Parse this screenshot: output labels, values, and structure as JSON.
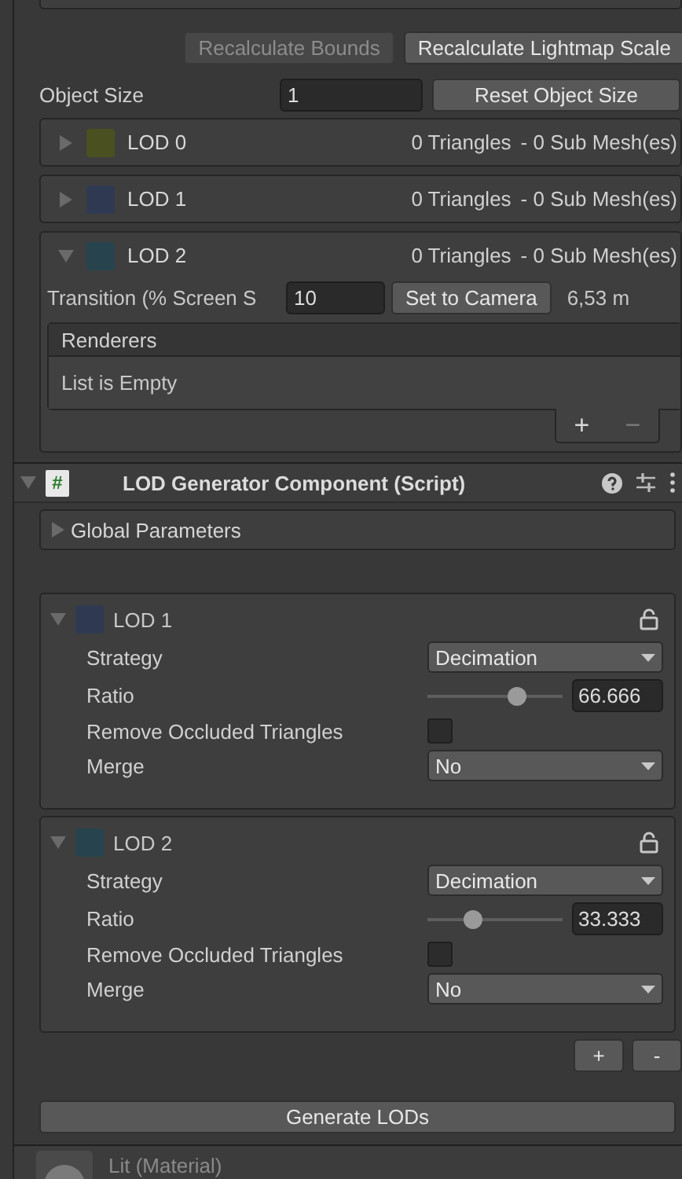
{
  "toolbar": {
    "buttons": [
      {
        "label": "Recalculate Bounds",
        "disabled": true
      },
      {
        "label": "Recalculate Lightmap Scale",
        "disabled": false
      }
    ]
  },
  "object_size": {
    "label": "Object Size",
    "value": "1",
    "button": "Reset Object Size"
  },
  "lod_group": [
    {
      "name": "LOD 0",
      "color": "#4a5020",
      "expanded": false,
      "triangles": "0 Triangles",
      "submeshes": "- 0 Sub Mesh(es)"
    },
    {
      "name": "LOD 1",
      "color": "#2f3a52",
      "expanded": false,
      "triangles": "0 Triangles",
      "submeshes": "- 0 Sub Mesh(es)"
    },
    {
      "name": "LOD 2",
      "color": "#27444e",
      "expanded": true,
      "triangles": "0 Triangles",
      "submeshes": "- 0 Sub Mesh(es)"
    }
  ],
  "transition": {
    "label": "Transition (% Screen S",
    "value": "10",
    "button": "Set to Camera",
    "reading": "6,53 m"
  },
  "renderers": {
    "header": "Renderers",
    "empty_text": "List is Empty",
    "add": "+",
    "remove": "−"
  },
  "component": {
    "title": "LOD Generator Component (Script)",
    "expanded": true,
    "icon_glyph": "#",
    "global_parameters": {
      "label": "Global Parameters",
      "expanded": false
    },
    "lods": [
      {
        "name": "LOD 1",
        "color": "#2f3a52",
        "expanded": true,
        "strategy_label": "Strategy",
        "strategy": "Decimation",
        "ratio_label": "Ratio",
        "level": 0.667,
        "ratio": "66.666",
        "occluded_label": "Remove Occluded Triangles",
        "checked": false,
        "merge_label": "Merge",
        "merge": "No"
      },
      {
        "name": "LOD 2",
        "color": "#27444e",
        "expanded": true,
        "strategy_label": "Strategy",
        "strategy": "Decimation",
        "ratio_label": "Ratio",
        "level": 0.333,
        "ratio": "33.333",
        "occluded_label": "Remove Occluded Triangles",
        "checked": false,
        "merge_label": "Merge",
        "merge": "No"
      }
    ],
    "add": "+",
    "remove": "-",
    "generate": "Generate LODs"
  },
  "next_component": {
    "title": "Lit (Material)"
  }
}
